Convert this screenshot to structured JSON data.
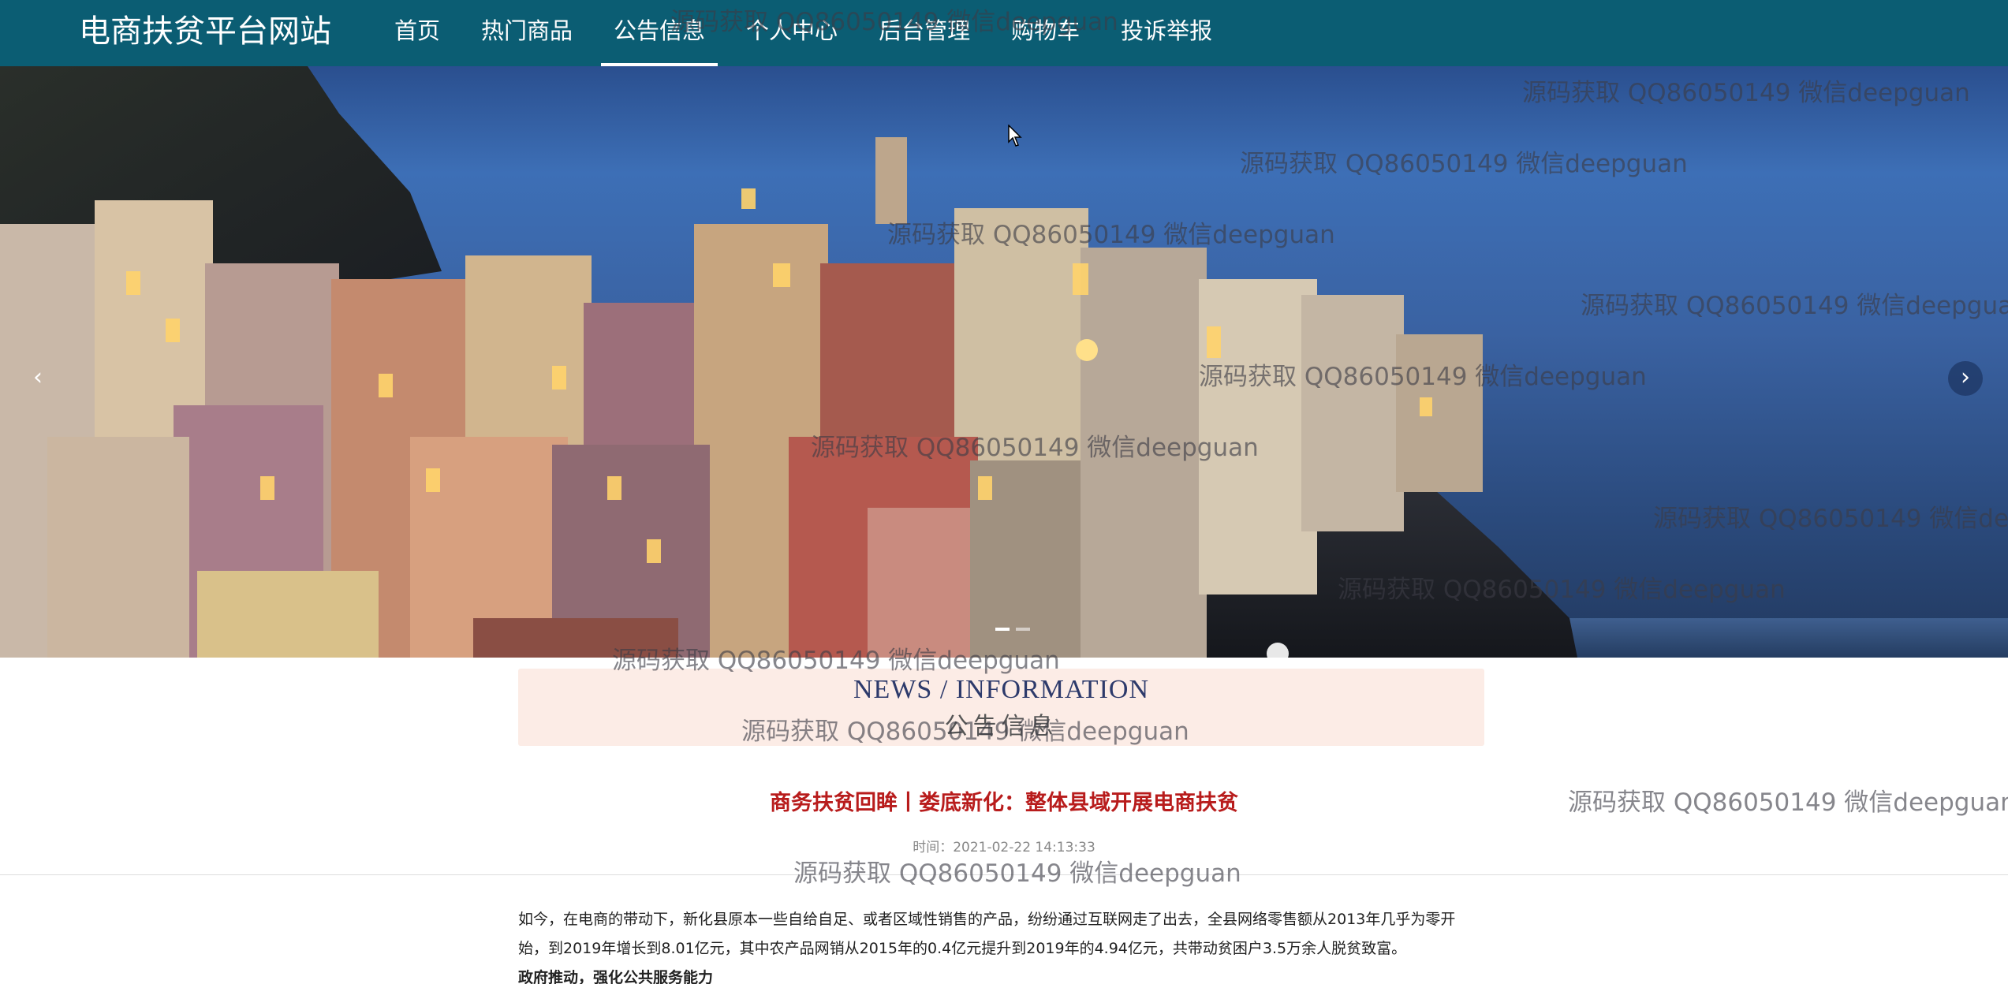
{
  "header": {
    "brand": "电商扶贫平台网站",
    "nav": [
      {
        "label": "首页"
      },
      {
        "label": "热门商品"
      },
      {
        "label": "公告信息",
        "active": true
      },
      {
        "label": "个人中心"
      },
      {
        "label": "后台管理"
      },
      {
        "label": "购物车"
      },
      {
        "label": "投诉举报"
      }
    ]
  },
  "carousel": {
    "prev_icon": "chevron-left-icon",
    "next_icon": "chevron-right-icon",
    "prev_glyph": "‹",
    "next_glyph": "›",
    "slides": 2,
    "active_slide": 1
  },
  "news": {
    "heading_en": "NEWS / INFORMATION",
    "heading_cn": "公告信息"
  },
  "article": {
    "title": "商务扶贫回眸丨娄底新化：整体县域开展电商扶贫",
    "time": "时间：2021-02-22 14:13:33",
    "paragraphs": [
      "如今，在电商的带动下，新化县原本一些自给自足、或者区域性销售的产品，纷纷通过互联网走了出去，全县网络零售额从2013年几乎为零开始，到2019年增长到8.01亿元，其中农产品网销从2015年的0.4亿元提升到2019年的4.94亿元，共带动贫困户3.5万余人脱贫致富。"
    ],
    "subheading": "政府推动，强化公共服务能力"
  },
  "watermark": {
    "text": "源码获取 QQ86050149 微信deepguan"
  },
  "colors": {
    "header_bg": "#0b5d73",
    "news_box_bg": "#fcece6",
    "title_red": "#b81c1c"
  }
}
